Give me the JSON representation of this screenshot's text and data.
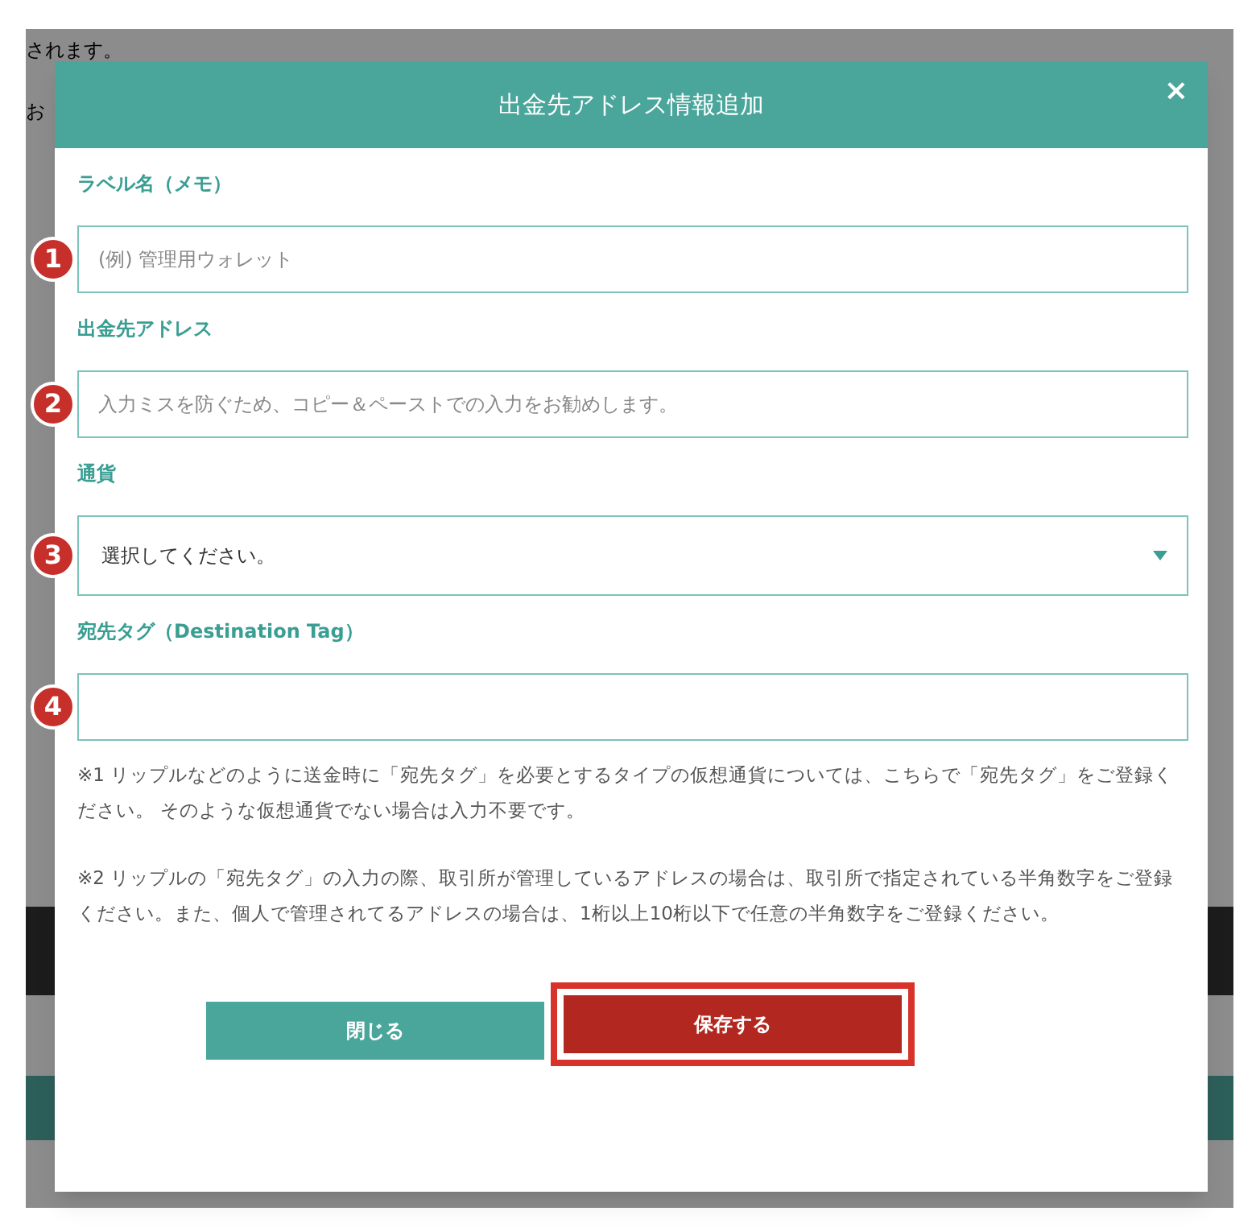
{
  "background_page": {
    "texts": [
      "されます。",
      "お"
    ]
  },
  "dialog": {
    "title": "出金先アドレス情報追加",
    "close": "×",
    "fields": [
      {
        "kind": "input",
        "label": "ラベル名（メモ）",
        "placeholder": "(例) 管理用ウォレット",
        "marker": "1"
      },
      {
        "kind": "input",
        "label": "出金先アドレス",
        "placeholder": "入力ミスを防ぐため、コピー＆ペーストでの入力をお勧めします。",
        "marker": "2"
      },
      {
        "kind": "select",
        "label": "通貨",
        "value": "選択してください。",
        "marker": "3"
      },
      {
        "kind": "input",
        "label": "宛先タグ（Destination Tag）",
        "marker": "4"
      }
    ],
    "notes": [
      "※1 リップルなどのように送金時に「宛先タグ」を必要とするタイプの仮想通貨については、こちらで「宛先タグ」をご登録ください。 そのような仮想通貨でない場合は入力不要です。",
      "※2 リップルの「宛先タグ」の入力の際、取引所が管理しているアドレスの場合は、取引所で指定されている半角数字をご登録ください。また、個人で管理されてるアドレスの場合は、1桁以上10桁以下で任意の半角数字をご登録ください。"
    ],
    "buttons": [
      {
        "kind": "close",
        "label": "閉じる",
        "highlighted": false
      },
      {
        "kind": "save",
        "label": "保存する",
        "highlighted": true
      }
    ]
  }
}
